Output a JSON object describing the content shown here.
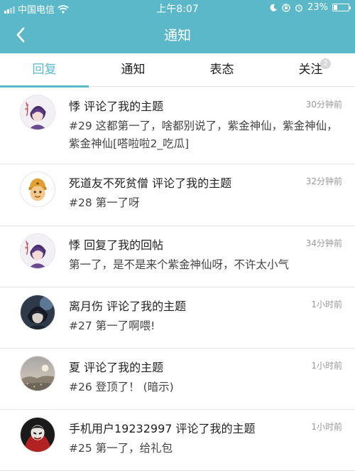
{
  "status_bar": {
    "carrier": "中国电信",
    "time": "上午8:07",
    "battery_text": "23%",
    "battery_level": 0.23
  },
  "nav": {
    "title": "通知"
  },
  "tabs": [
    {
      "label": "回复",
      "active": true
    },
    {
      "label": "通知",
      "active": false
    },
    {
      "label": "表态",
      "active": false
    },
    {
      "label": "关注",
      "active": false,
      "badge": "2"
    }
  ],
  "items": [
    {
      "title": "悸 评论了我的主题",
      "time": "30分钟前",
      "body": "#29 这都第一了，啥都别说了，紫金神仙，紫金神仙，紫金神仙[嗒啦啦2_吃瓜]",
      "avatar": "purple-anime"
    },
    {
      "title": "死道友不死贫僧 评论了我的主题",
      "time": "32分钟前",
      "body": "#28 第一了呀",
      "avatar": "cartoon-helmet"
    },
    {
      "title": "悸 回复了我的回帖",
      "time": "34分钟前",
      "body": "第一了，是不是来个紫金神仙呀，不许太小气",
      "avatar": "purple-anime"
    },
    {
      "title": "离月伤 评论了我的主题",
      "time": "1小时前",
      "body": "#27 第一了啊喂!",
      "avatar": "dark-anime"
    },
    {
      "title": "夏 评论了我的主题",
      "time": "1小时前",
      "body": "#26 登顶了！ (暗示)",
      "avatar": "landscape"
    },
    {
      "title": "手机用户19232997 评论了我的主题",
      "time": "1小时前",
      "body": "#25 第一了，给礼包",
      "avatar": "red-character"
    }
  ],
  "colors": {
    "header": "#5bb8c9",
    "accent": "#5bb8c9"
  }
}
